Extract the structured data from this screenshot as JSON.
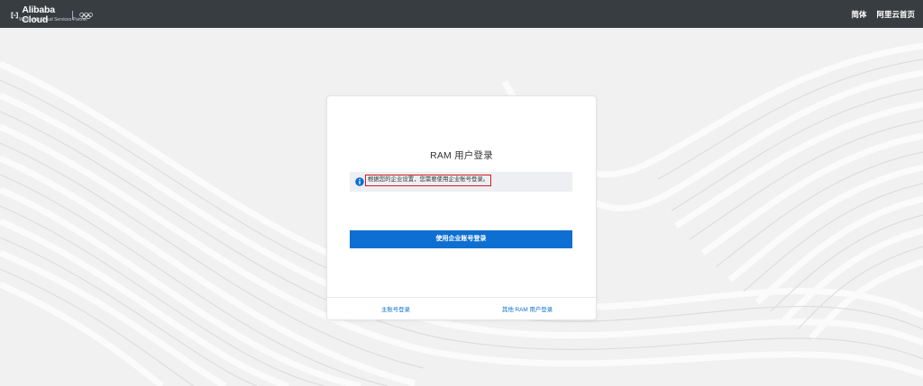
{
  "header": {
    "logo_text": "Alibaba Cloud",
    "logo_tagline": "Worldwide Cloud Services Partner",
    "nav": [
      {
        "label": "简体"
      },
      {
        "label": "阿里云首页"
      }
    ]
  },
  "login": {
    "title": "RAM 用户登录",
    "notice": "根据您的企业设置，您需要使用企业账号登录。",
    "primary_button": "使用企业账号登录",
    "footer": {
      "left_link": "主账号登录",
      "right_link": "其他 RAM 用户登录"
    }
  },
  "colors": {
    "header_bg": "#373d41",
    "accent": "#0c6fd1",
    "highlight_border": "#d71920"
  },
  "icons": {
    "notice": "info-icon",
    "brand": "alibaba-cloud-logo-icon",
    "olympic": "olympic-rings-icon"
  }
}
